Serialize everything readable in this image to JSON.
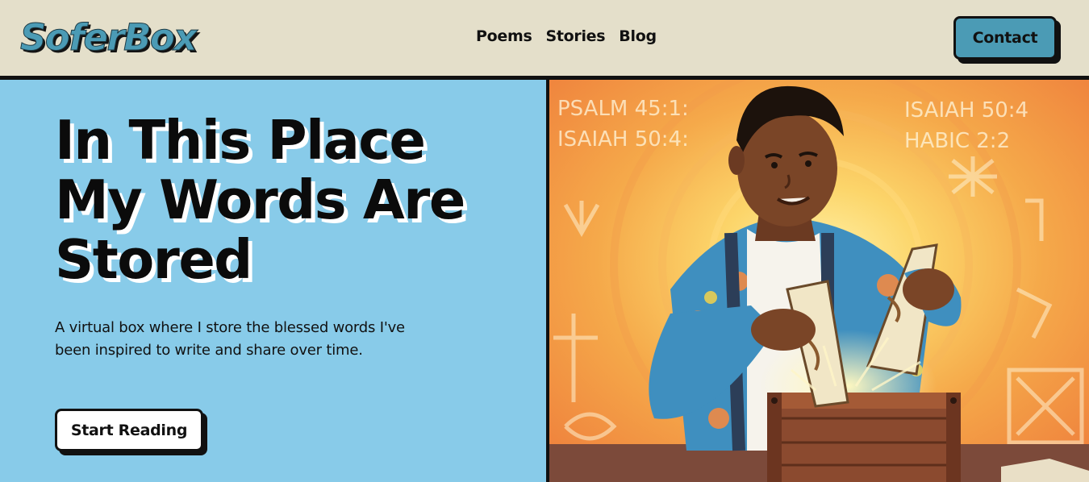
{
  "header": {
    "logo": "SoferBox",
    "nav": [
      {
        "label": "Poems"
      },
      {
        "label": "Stories"
      },
      {
        "label": "Blog"
      }
    ],
    "contact_label": "Contact"
  },
  "hero": {
    "title_lines": [
      "In This Place",
      "My Words Are",
      "Stored"
    ],
    "description": "A virtual box where I store the blessed words I've been inspired to write and share over time.",
    "cta_label": "Start Reading"
  },
  "illustration": {
    "wall_text": [
      "PSALM 45:1:",
      "ISAIAH 50:4:",
      "ISAIAH 50:4",
      "HABIC 2:2"
    ]
  },
  "colors": {
    "header_bg": "#e4dfca",
    "hero_bg": "#88cbe9",
    "accent": "#4b9bb5",
    "border": "#111111"
  }
}
